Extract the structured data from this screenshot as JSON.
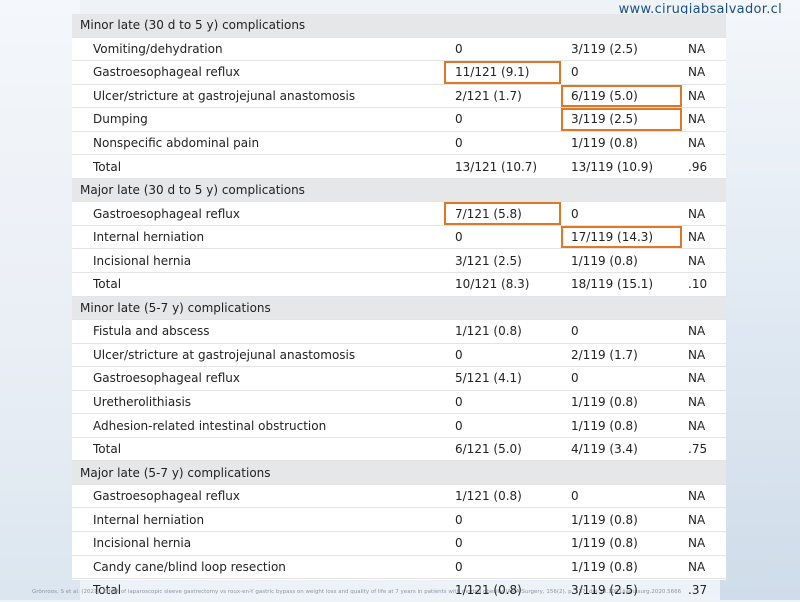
{
  "watermark": "www.cirugiabsalvador.cl",
  "footer": "Grönroos, S et al. (2021). Effect of laparoscopic sleeve gastrectomy vs roux-en-Y gastric bypass on weight loss and quality of life at 7 years in patients with morbid obesity. JAMA Surgery, 156(2), p. 137. doi:10.1001/jamasurg.2020.5666",
  "highlight_color": "#e07726",
  "sections": [
    {
      "title": "Minor late (30 d to 5 y) complications",
      "rows": [
        {
          "label": "Vomiting/dehydration",
          "c1": "0",
          "c2": "3/119 (2.5)",
          "c3": "NA",
          "hl": []
        },
        {
          "label": "Gastroesophageal reflux",
          "c1": "11/121 (9.1)",
          "c2": "0",
          "c3": "NA",
          "hl": [
            "c1"
          ]
        },
        {
          "label": "Ulcer/stricture at gastrojejunal anastomosis",
          "c1": "2/121 (1.7)",
          "c2": "6/119 (5.0)",
          "c3": "NA",
          "hl": [
            "c2"
          ]
        },
        {
          "label": "Dumping",
          "c1": "0",
          "c2": "3/119 (2.5)",
          "c3": "NA",
          "hl": [
            "c2"
          ]
        },
        {
          "label": "Nonspecific abdominal pain",
          "c1": "0",
          "c2": "1/119 (0.8)",
          "c3": "NA",
          "hl": []
        },
        {
          "label": "Total",
          "c1": "13/121 (10.7)",
          "c2": "13/119 (10.9)",
          "c3": ".96",
          "hl": []
        }
      ]
    },
    {
      "title": "Major late (30 d to 5 y) complications",
      "rows": [
        {
          "label": "Gastroesophageal reflux",
          "c1": "7/121 (5.8)",
          "c2": "0",
          "c3": "NA",
          "hl": [
            "c1"
          ]
        },
        {
          "label": "Internal herniation",
          "c1": "0",
          "c2": "17/119 (14.3)",
          "c3": "NA",
          "hl": [
            "c2"
          ]
        },
        {
          "label": "Incisional hernia",
          "c1": "3/121 (2.5)",
          "c2": "1/119 (0.8)",
          "c3": "NA",
          "hl": []
        },
        {
          "label": "Total",
          "c1": "10/121 (8.3)",
          "c2": "18/119 (15.1)",
          "c3": ".10",
          "hl": []
        }
      ]
    },
    {
      "title": "Minor late (5-7 y) complications",
      "rows": [
        {
          "label": "Fistula and abscess",
          "c1": "1/121 (0.8)",
          "c2": "0",
          "c3": "NA",
          "hl": []
        },
        {
          "label": "Ulcer/stricture at gastrojejunal anastomosis",
          "c1": "0",
          "c2": "2/119 (1.7)",
          "c3": "NA",
          "hl": []
        },
        {
          "label": "Gastroesophageal reflux",
          "c1": "5/121 (4.1)",
          "c2": "0",
          "c3": "NA",
          "hl": []
        },
        {
          "label": "Uretherolithiasis",
          "c1": "0",
          "c2": "1/119 (0.8)",
          "c3": "NA",
          "hl": []
        },
        {
          "label": "Adhesion-related intestinal obstruction",
          "c1": "0",
          "c2": "1/119 (0.8)",
          "c3": "NA",
          "hl": []
        },
        {
          "label": "Total",
          "c1": "6/121 (5.0)",
          "c2": "4/119 (3.4)",
          "c3": ".75",
          "hl": []
        }
      ]
    },
    {
      "title": "Major late (5-7 y) complications",
      "rows": [
        {
          "label": "Gastroesophageal reflux",
          "c1": "1/121 (0.8)",
          "c2": "0",
          "c3": "NA",
          "hl": []
        },
        {
          "label": "Internal herniation",
          "c1": "0",
          "c2": "1/119 (0.8)",
          "c3": "NA",
          "hl": []
        },
        {
          "label": "Incisional hernia",
          "c1": "0",
          "c2": "1/119 (0.8)",
          "c3": "NA",
          "hl": []
        },
        {
          "label": "Candy cane/blind loop resection",
          "c1": "0",
          "c2": "1/119 (0.8)",
          "c3": "NA",
          "hl": []
        },
        {
          "label": "Total",
          "c1": "1/121 (0.8)",
          "c2": "3/119 (2.5)",
          "c3": ".37",
          "hl": []
        }
      ]
    }
  ]
}
